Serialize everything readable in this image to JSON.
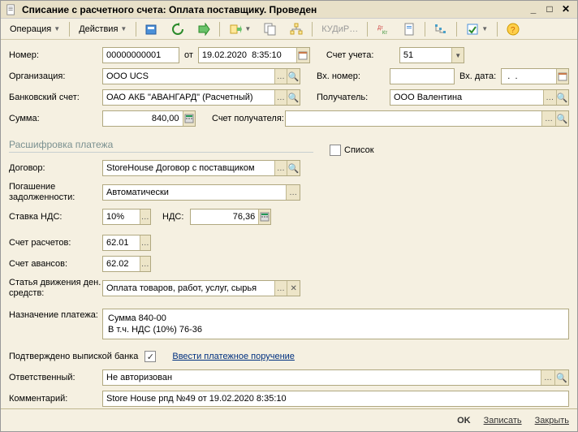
{
  "window_title": "Списание с расчетного счета: Оплата поставщику. Проведен",
  "toolbar": {
    "operation": "Операция",
    "actions": "Действия",
    "kudir": "КУДиР…"
  },
  "labels": {
    "number": "Номер:",
    "from": "от",
    "org": "Организация:",
    "bank_acc": "Банковский счет:",
    "sum": "Сумма:",
    "section": "Расшифровка платежа",
    "contract": "Договор:",
    "debt": "Погашение задолженности:",
    "vat_rate": "Ставка НДС:",
    "vat": "НДС:",
    "acc_settle": "Счет расчетов:",
    "acc_advance": "Счет авансов:",
    "cash_flow": "Статья движения ден. средств:",
    "purpose": "Назначение платежа:",
    "confirmed": "Подтверждено выпиской банка",
    "link_payment": "Ввести платежное поручение",
    "responsible": "Ответственный:",
    "comment": "Комментарий:",
    "uchet": "Счет учета:",
    "in_num": "Вх. номер:",
    "in_date": "Вх. дата:",
    "recipient": "Получатель:",
    "recipient_acc": "Счет получателя:",
    "list": "Список"
  },
  "values": {
    "number": "00000000001",
    "date": "19.02.2020  8:35:10",
    "org": "ООО UCS",
    "bank_acc": "ОАО АКБ \"АВАНГАРД\" (Расчетный)",
    "sum": "840,00",
    "contract": "StoreHouse Договор с поставщиком",
    "debt": "Автоматически",
    "vat_rate": "10%",
    "vat": "76,36",
    "acc_settle": "62.01",
    "acc_advance": "62.02",
    "cash_flow": "Оплата товаров, работ, услуг, сырья",
    "purpose_l1": "Сумма 840-00",
    "purpose_l2": "В т.ч. НДС (10%) 76-36",
    "responsible": "Не авторизован",
    "comment": "Store House рпд №49 от 19.02.2020 8:35:10",
    "uchet": "51",
    "in_num": "",
    "in_date": " .  .    ",
    "recipient": "ООО Валентина",
    "recipient_acc": ""
  },
  "footer": {
    "ok": "OK",
    "save": "Записать",
    "close": "Закрыть"
  }
}
